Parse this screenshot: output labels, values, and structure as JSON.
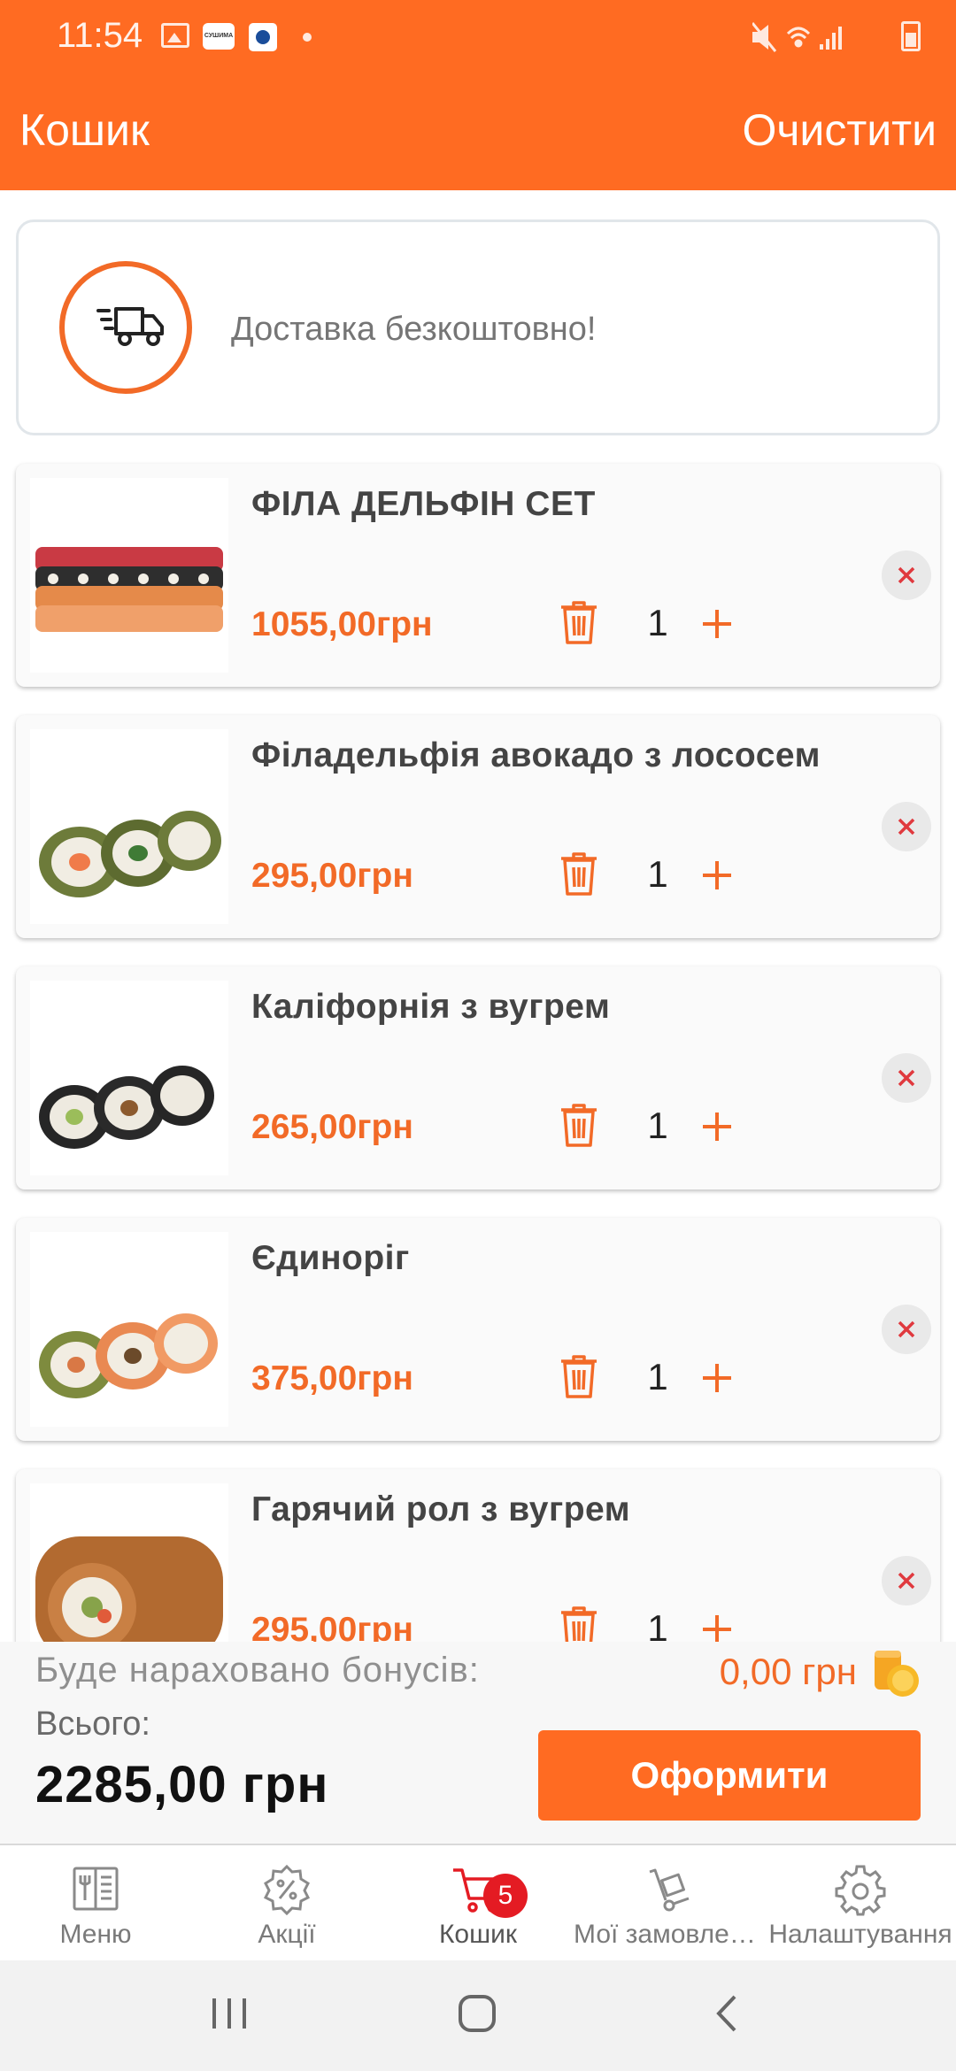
{
  "status_bar": {
    "time": "11:54",
    "app_icon_text": "СУШИМА"
  },
  "header": {
    "title": "Кошик",
    "clear_label": "Очистити"
  },
  "delivery": {
    "text": "Доставка безкоштовно!",
    "icon": "delivery-truck-icon"
  },
  "cart": {
    "items": [
      {
        "name": "ФІЛА ДЕЛЬФІН СЕТ",
        "price": "1055,00грн",
        "qty": "1"
      },
      {
        "name": "Філадельфія авокадо з лососем",
        "price": "295,00грн",
        "qty": "1"
      },
      {
        "name": "Каліфорнія з вугрем",
        "price": "265,00грн",
        "qty": "1"
      },
      {
        "name": "Єдиноріг",
        "price": "375,00грн",
        "qty": "1"
      },
      {
        "name": "Гарячий рол з вугрем",
        "price": "295,00грн",
        "qty": "1"
      }
    ]
  },
  "summary": {
    "bonus_label": "Буде нараховано бонусів:",
    "bonus_value": "0,00 грн",
    "total_label": "Всього:",
    "total_value": "2285,00 грн",
    "checkout_label": "Оформити"
  },
  "bottom_nav": {
    "items": [
      {
        "label": "Меню",
        "icon": "menu-book-icon"
      },
      {
        "label": "Акції",
        "icon": "discount-icon"
      },
      {
        "label": "Кошик",
        "icon": "cart-icon",
        "badge": "5",
        "active": true
      },
      {
        "label": "Мої замовлення",
        "icon": "orders-icon"
      },
      {
        "label": "Налаштування",
        "icon": "settings-icon"
      }
    ]
  },
  "colors": {
    "accent": "#ff6b22",
    "price": "#f26a27",
    "remove": "#e0393e"
  }
}
